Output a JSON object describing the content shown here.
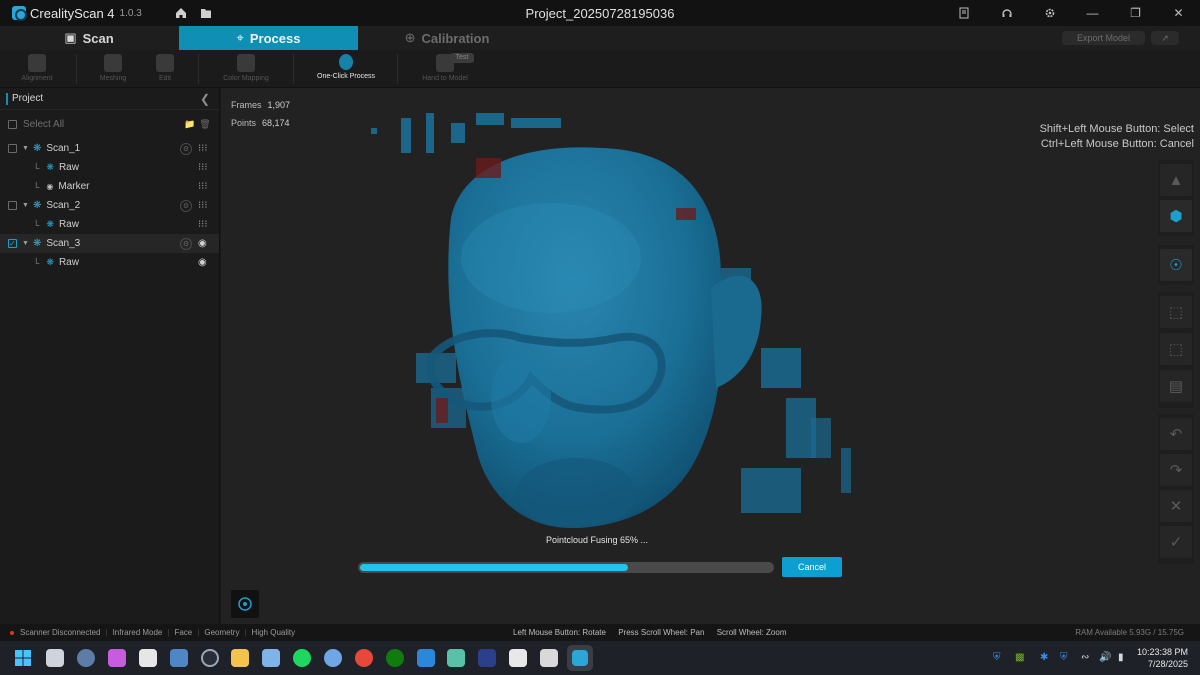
{
  "app": {
    "name": "CrealityScan 4",
    "version": "1.0.3",
    "window_title": "Project_20250728195036"
  },
  "modes": {
    "scan": "Scan",
    "process": "Process",
    "calibration": "Calibration",
    "export": "Export Model",
    "share": "↗"
  },
  "toolbar": {
    "tools": [
      "Alignment",
      "Meshing",
      "Edit",
      "Color Mapping",
      "One-Click Process",
      "Hand to Model"
    ],
    "test_badge": "Test"
  },
  "project": {
    "title": "Project",
    "select_all": "Select All",
    "items": [
      {
        "label": "Scan_1",
        "kind": "scan",
        "checked": false
      },
      {
        "label": "Raw",
        "kind": "raw"
      },
      {
        "label": "Marker",
        "kind": "marker"
      },
      {
        "label": "Scan_2",
        "kind": "scan",
        "checked": false
      },
      {
        "label": "Raw",
        "kind": "raw"
      },
      {
        "label": "Scan_3",
        "kind": "scan",
        "checked": true
      },
      {
        "label": "Raw",
        "kind": "raw"
      }
    ]
  },
  "viewport": {
    "frames_label": "Frames",
    "frames_value": "1,907",
    "points_label": "Points",
    "points_value": "68,174",
    "hint_select": "Shift+Left Mouse Button: Select",
    "hint_cancel": "Ctrl+Left Mouse Button: Cancel"
  },
  "progress": {
    "label": "Pointcloud Fusing 65% ...",
    "fraction": 0.65,
    "cancel": "Cancel"
  },
  "status": {
    "scanner": "Scanner Disconnected",
    "mode": "Infrared Mode",
    "target": "Face",
    "feature": "Geometry",
    "quality": "High Quality",
    "hint_rotate": "Left Mouse Button: Rotate",
    "hint_pan": "Press Scroll Wheel: Pan",
    "hint_zoom": "Scroll Wheel: Zoom",
    "ram": "RAM Available 5.93G / 15.75G"
  },
  "clock": {
    "time": "10:23:38 PM",
    "date": "7/28/2025"
  },
  "colors": {
    "accent": "#0e8fb3",
    "scan_blue": "#1a6f96",
    "progress": "#1fc6e8",
    "error_dot": "#d33a2c"
  },
  "icons": {
    "titlebar": [
      "home-icon",
      "folder-icon",
      "notes-icon",
      "headset-icon",
      "settings-icon",
      "minimize-icon",
      "maximize-icon",
      "close-icon"
    ],
    "right_tools": [
      "eraser-icon",
      "cube-view-icon",
      "orbit-icon",
      "box-select-icon",
      "box-deselect-icon",
      "invert-select-icon",
      "undo-icon",
      "redo-icon",
      "delete-icon",
      "confirm-icon"
    ]
  }
}
